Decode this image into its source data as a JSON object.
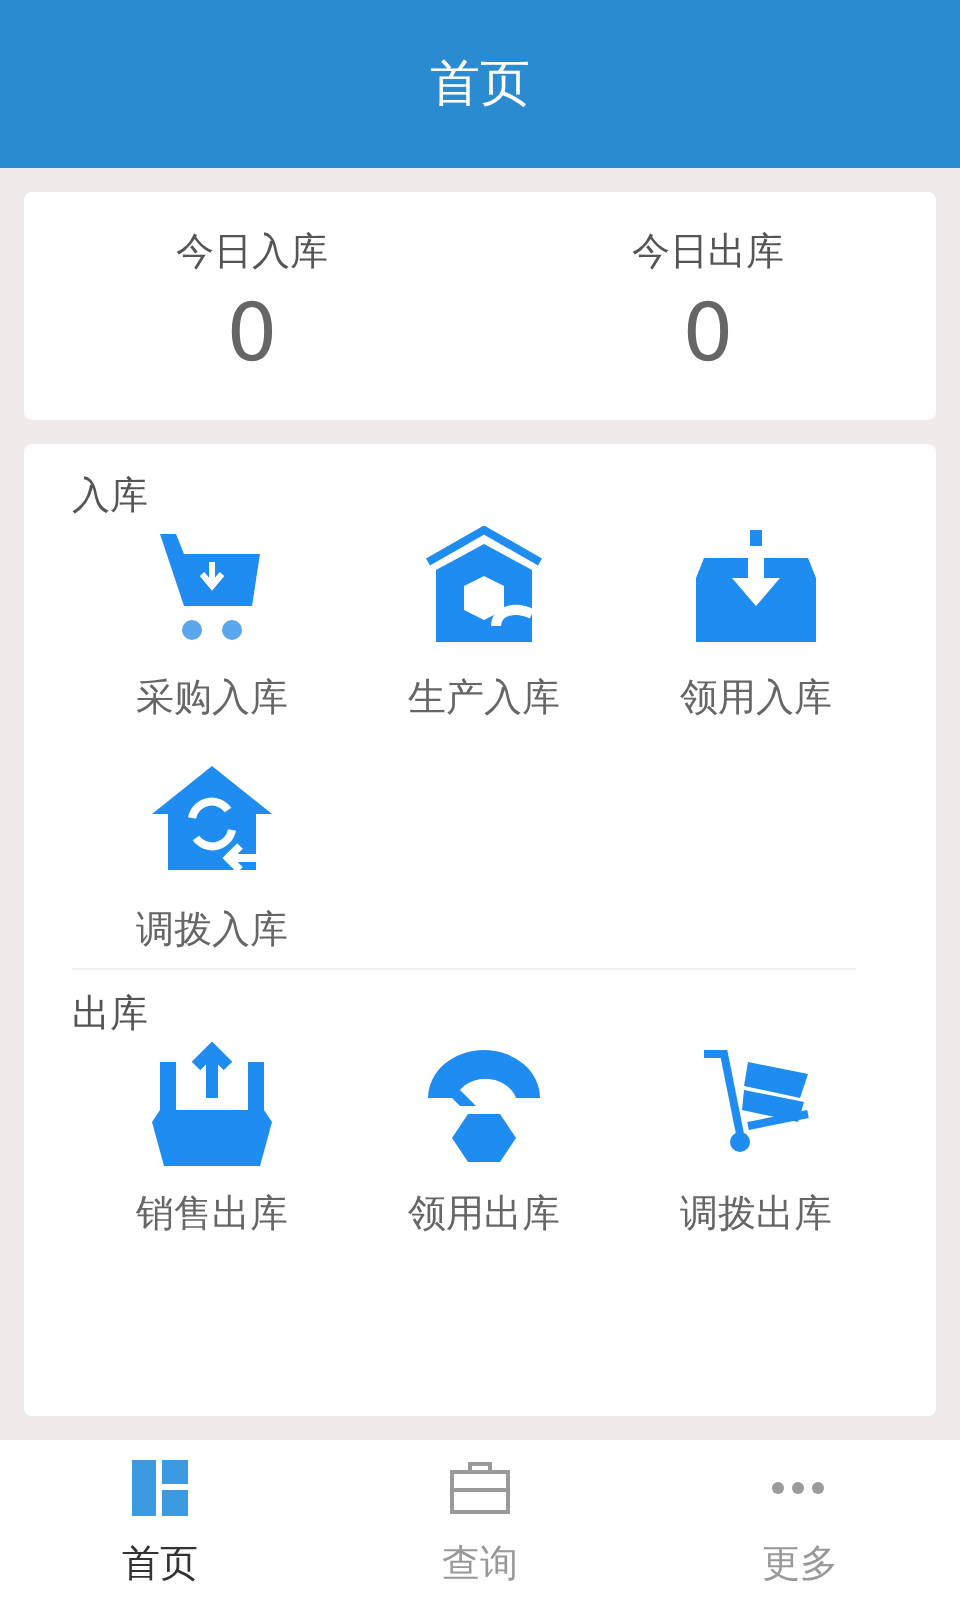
{
  "header": {
    "title": "首页"
  },
  "summary": [
    {
      "label": "今日入库",
      "value": "0"
    },
    {
      "label": "今日出库",
      "value": "0"
    }
  ],
  "sections": [
    {
      "title": "入库",
      "items": [
        {
          "label": "采购入库",
          "kind": "cart"
        },
        {
          "label": "生产入库",
          "kind": "factory"
        },
        {
          "label": "领用入库",
          "kind": "inbox"
        },
        {
          "label": "调拨入库",
          "kind": "transfer"
        }
      ]
    },
    {
      "title": "出库",
      "items": [
        {
          "label": "销售出库",
          "kind": "outbox"
        },
        {
          "label": "领用出库",
          "kind": "arc"
        },
        {
          "label": "调拨出库",
          "kind": "trolley"
        }
      ]
    }
  ],
  "tabs": [
    {
      "label": "首页",
      "selected": true,
      "kind": "home"
    },
    {
      "label": "查询",
      "selected": false,
      "kind": "query"
    },
    {
      "label": "更多",
      "selected": false,
      "kind": "more"
    }
  ]
}
